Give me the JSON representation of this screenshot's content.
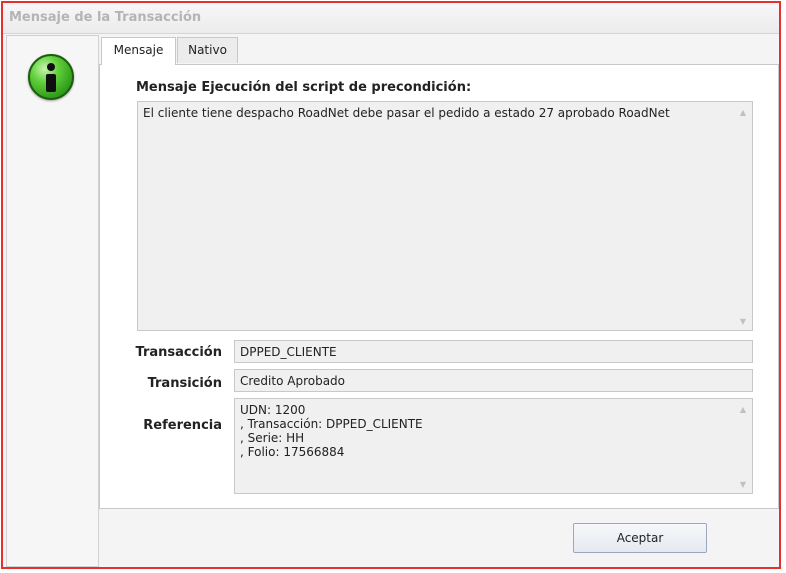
{
  "window": {
    "title": "Mensaje de la Transacción"
  },
  "tabs": [
    {
      "label": "Mensaje",
      "active": true
    },
    {
      "label": "Nativo",
      "active": false
    }
  ],
  "message": {
    "heading": "Mensaje Ejecución del script de precondición:",
    "body": "El cliente tiene despacho RoadNet debe pasar el pedido a estado 27 aprobado RoadNet"
  },
  "fields": {
    "transaccion": {
      "label": "Transacción",
      "value": "DPPED_CLIENTE"
    },
    "transicion": {
      "label": "Transición",
      "value": "Credito Aprobado"
    },
    "referencia": {
      "label": "Referencia",
      "value": "UDN: 1200\n, Transacción: DPPED_CLIENTE\n, Serie: HH\n, Folio: 17566884"
    }
  },
  "buttons": {
    "accept": "Aceptar"
  },
  "icons": {
    "info": "info-icon",
    "scroll_up": "scroll-up-arrow-icon",
    "scroll_down": "scroll-down-arrow-icon"
  },
  "colors": {
    "border_highlight": "#e53030",
    "info_green": "#3fae27"
  }
}
